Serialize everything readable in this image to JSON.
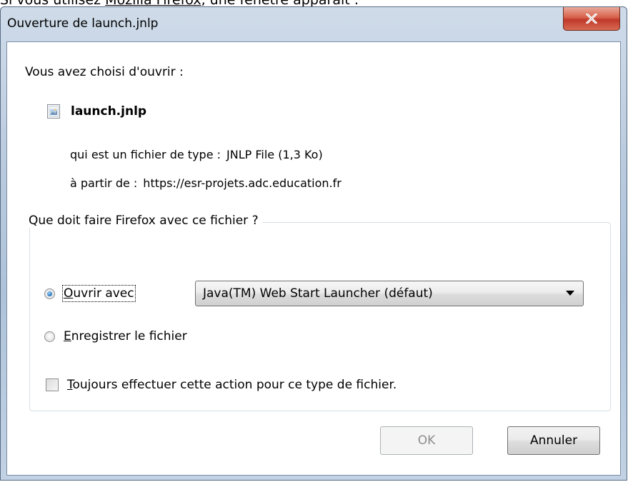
{
  "document": {
    "top_text_prefix": "Si vous utilisez ",
    "top_text_link": "Mozilla Firefox",
    "top_text_suffix": ", une fenêtre apparaît :"
  },
  "window": {
    "title": "Ouverture de launch.jnlp",
    "close_label": "X"
  },
  "dialog": {
    "intro": "Vous avez choisi d'ouvrir :",
    "file_name": "launch.jnlp",
    "file_icon": "document-icon",
    "type_label": "qui est un fichier de type :",
    "type_value": "JNLP File (1,3 Ko)",
    "from_label": "à partir de :",
    "from_value": "https://esr-projets.adc.education.fr",
    "group_title": "Que doit faire Firefox avec ce fichier ?",
    "open_with": {
      "accesskey": "O",
      "rest": "uvrir avec",
      "checked": true
    },
    "open_with_app": "Java(TM) Web Start Launcher (défaut)",
    "save_file": {
      "accesskey": "E",
      "rest": "nregistrer le fichier",
      "checked": false
    },
    "always": {
      "accesskey": "T",
      "rest": "oujours effectuer cette action pour ce type de fichier.",
      "checked": false
    }
  },
  "buttons": {
    "ok": "OK",
    "cancel": "Annuler"
  }
}
